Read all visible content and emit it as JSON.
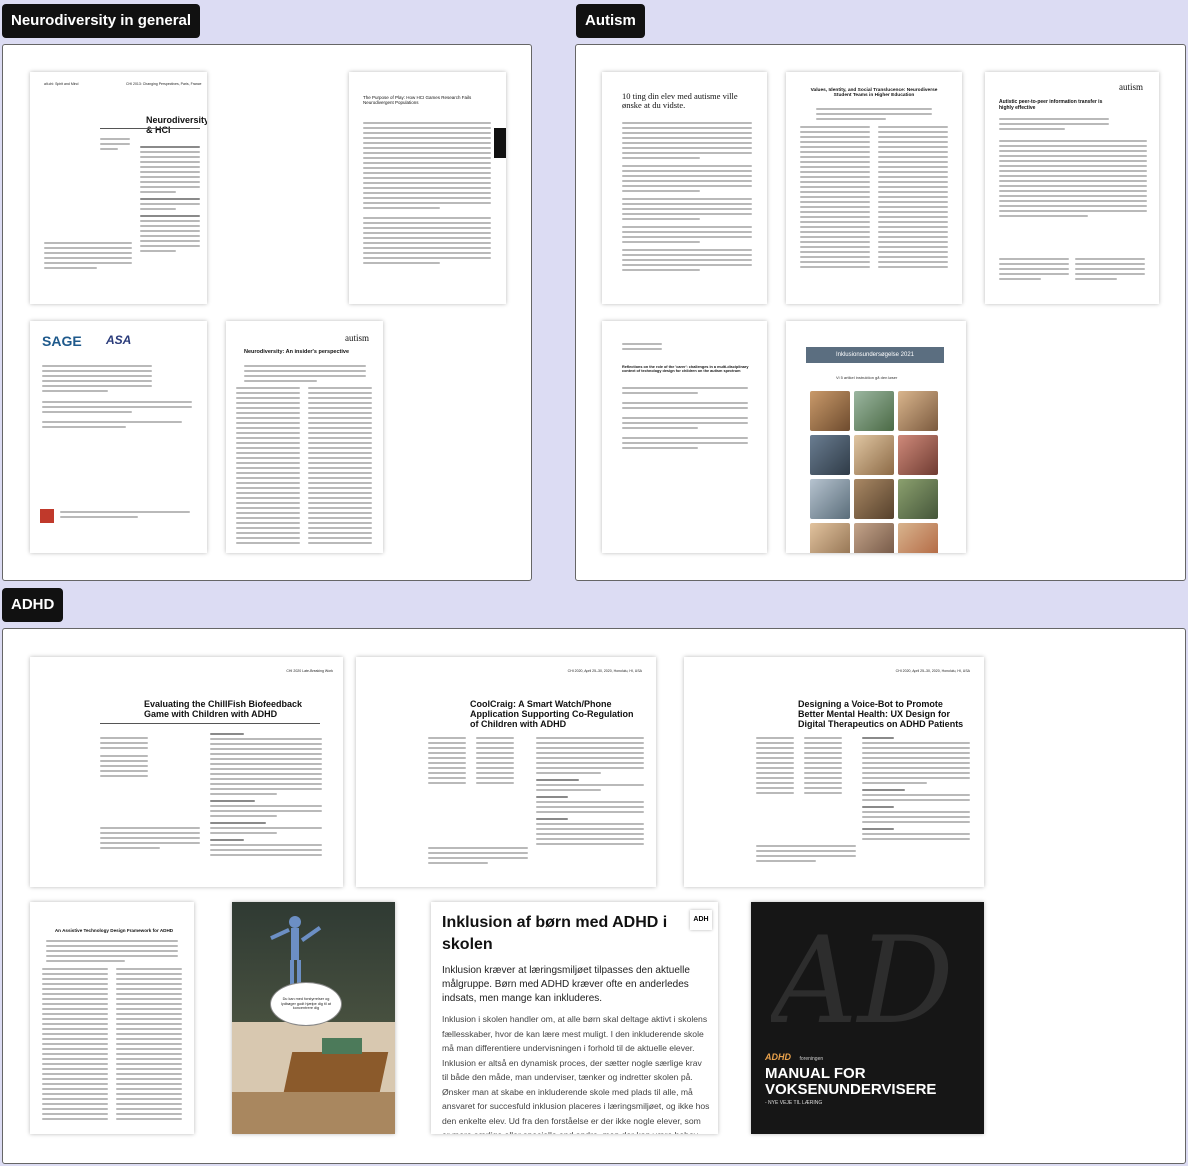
{
  "sections": {
    "neuro": "Neurodiversity in general",
    "autism": "Autism",
    "adhd": "ADHD"
  },
  "docs": {
    "n1": {
      "header_left": "alt.chi: Spirit and Mind",
      "header_right": "CHI 2013: Changing Perspectives, Paris, France",
      "title": "Neurodiversity & HCI"
    },
    "n2": {
      "title": "The Purpose of Play: How HCI Games Research Fails Neurodivergent Populations"
    },
    "n3": {
      "logo": "SAGE",
      "logo2": "ASA"
    },
    "n4": {
      "title": "Neurodiversity: An insider's perspective",
      "logo": "autism"
    },
    "a1": {
      "title": "10 ting din elev med autisme ville ønske at du vidste."
    },
    "a2": {
      "title": "Values, Identity, and Social Translucence: Neurodiverse Student Teams in Higher Education"
    },
    "a3": {
      "title": "Autistic peer-to-peer information transfer is highly effective",
      "logo": "autism"
    },
    "a4": {
      "title": "Reflections on the role of the 'carer': challenges in a multi-disciplinary context of technology design for children on the autism spectrum"
    },
    "a5": {
      "banner": "Inklusionsundersøgelse 2021",
      "subtitle": "Vi 5 artikel instruktion gå den løser"
    },
    "d1": {
      "header": "CHI 2020 Late-Breaking Work",
      "title": "Evaluating the ChillFish Biofeedback Game with Children with ADHD"
    },
    "d2": {
      "header": "CHI 2020, April 25–30, 2020, Honolulu, HI, USA",
      "title": "CoolCraig: A Smart Watch/Phone Application Supporting Co-Regulation of Children with ADHD"
    },
    "d3": {
      "header": "CHI 2020, April 25–30, 2020, Honolulu, HI, USA",
      "title": "Designing a Voice-Bot to Promote Better Mental Health: UX Design for Digital Therapeutics on ADHD Patients"
    },
    "d4": {
      "title": "An Assistive Technology Design Framework for ADHD"
    },
    "d5": {
      "bubble": "Du kan med forstyrrelser og lydbøger godt hjælpe dig til at koncentrere dig"
    },
    "d6": {
      "title": "Inklusion af børn med ADHD i skolen",
      "logo": "ADH",
      "lead": "Inklusion kræver at læringsmiljøet tilpasses den aktuelle målgruppe. Børn med ADHD kræver ofte en anderledes indsats, men mange kan inkluderes.",
      "body": "Inklusion i skolen handler om, at alle børn skal deltage aktivt i skolens fællesskaber, hvor de kan lære mest muligt. I den inkluderende skole må man differentiere undervisningen i forhold til de aktuelle elever. Inklusion er altså en dynamisk proces, der sætter nogle særlige krav til både den måde, man underviser, tænker og indretter skolen på. Ønsker man at skabe en inkluderende skole med plads til alle, må ansvaret for succesfuld inklusion placeres i læringsmiljøet, og ikke hos den enkelte elev. Ud fra den forståelse er der ikke nogle elever, som er mere særlige eller specielle end andre, men der kan være behov for forskellige indsatser."
    },
    "d7": {
      "brand": "ADHD",
      "small": "foreningen",
      "title": "MANUAL FOR VOKSENUNDERVISERE",
      "subtitle": "- NYE VEJE TIL LÆRING"
    }
  },
  "colors": {
    "page_bg": "#dcdcf3",
    "label_bg": "#111111",
    "cover_dark": "#161616"
  }
}
